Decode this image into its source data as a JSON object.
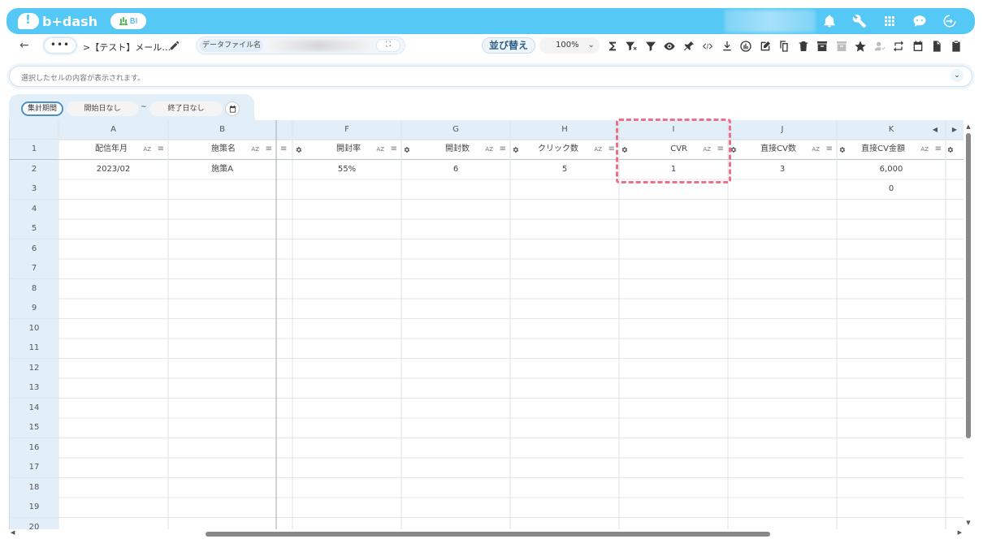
{
  "header": {
    "logo_text": "b+dash",
    "bi_badge": "BI",
    "icons": [
      "bell-icon",
      "wrench-icon",
      "grid-menu-icon",
      "chat-bot-icon",
      "logout-icon"
    ]
  },
  "toolbar": {
    "back": "←",
    "more": "•••",
    "breadcrumb": ">【テスト】メール…",
    "data_file_label": "データファイル名",
    "expand": "⛶",
    "sort_label": "並び替え",
    "zoom": "100%",
    "zoom_chevron": "⌄",
    "tool_icons": [
      "sum-icon",
      "filter-clear-icon",
      "filter-icon",
      "eye-icon",
      "pin-icon",
      "code-icon",
      "download-icon",
      "chart-icon",
      "edit-note-icon",
      "copy-icon",
      "delete-icon",
      "archive-icon",
      "archive-disabled-icon",
      "star-icon",
      "user-disabled-icon",
      "repeat-icon",
      "calendar-icon",
      "document-icon",
      "clipboard-icon"
    ]
  },
  "cellbar": {
    "placeholder": "選択したセルの内容が表示されます。",
    "chevron": "⌄"
  },
  "period": {
    "label": "集計期間",
    "start": "開始日なし",
    "tilde": "~",
    "end": "終了日なし"
  },
  "grid": {
    "columns": [
      "A",
      "B",
      "F",
      "G",
      "H",
      "I",
      "J",
      "K"
    ],
    "fields": [
      "配信年月",
      "施策名",
      "開封率",
      "開封数",
      "クリック数",
      "CVR",
      "直接CV数",
      "直接CV金額"
    ],
    "az": "AZ",
    "filter": "≡",
    "rows": [
      [
        "2023/02",
        "施策A",
        "55%",
        "6",
        "5",
        "1",
        "3",
        "6,000"
      ],
      [
        "",
        "",
        "",
        "",
        "",
        "",
        "",
        "0"
      ]
    ],
    "row_numbers": [
      "1",
      "2",
      "3",
      "4",
      "5",
      "6",
      "7",
      "8",
      "9",
      "10",
      "11",
      "12",
      "13",
      "14",
      "15",
      "16",
      "17",
      "18",
      "19",
      "20"
    ],
    "nav_left": "◀",
    "nav_right": "▶"
  },
  "scroll": {
    "up": "▲",
    "down": "▼",
    "left": "◀",
    "right": "▶"
  },
  "colors": {
    "header": "#56c8f5",
    "grid_header": "#e3eff8",
    "highlight": "#ef6f86"
  }
}
